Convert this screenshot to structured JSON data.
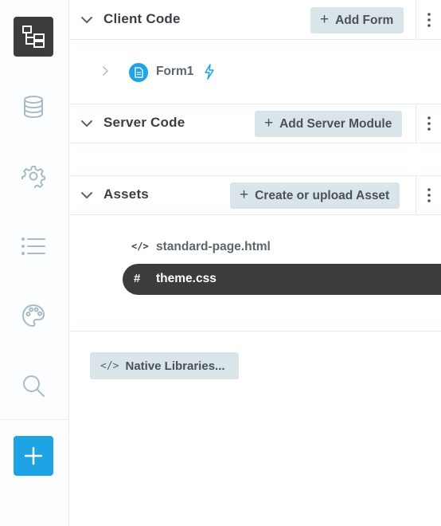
{
  "sidebar": {
    "items": [
      {
        "icon": "app-tree-icon",
        "active": true
      },
      {
        "icon": "database-icon"
      },
      {
        "icon": "gear-icon"
      },
      {
        "icon": "list-icon"
      },
      {
        "icon": "palette-icon"
      },
      {
        "icon": "search-icon"
      }
    ],
    "add_icon": "plus-icon"
  },
  "client_code": {
    "title": "Client Code",
    "add_label": "Add Form",
    "forms": [
      {
        "name": "Form1"
      }
    ]
  },
  "server_code": {
    "title": "Server Code",
    "add_label": "Add Server Module"
  },
  "assets": {
    "title": "Assets",
    "add_label": "Create or upload Asset",
    "files": [
      {
        "name": "standard-page.html",
        "icon": "code-icon",
        "selected": false
      },
      {
        "name": "theme.css",
        "icon": "hash-icon",
        "selected": true
      }
    ]
  },
  "native_libraries": {
    "label": "Native Libraries..."
  },
  "colors": {
    "accent": "#1ea4e4",
    "active_bg": "#3c3c3c",
    "button_bg": "#d9e5e9",
    "icon_gray": "#a9bcc4"
  }
}
